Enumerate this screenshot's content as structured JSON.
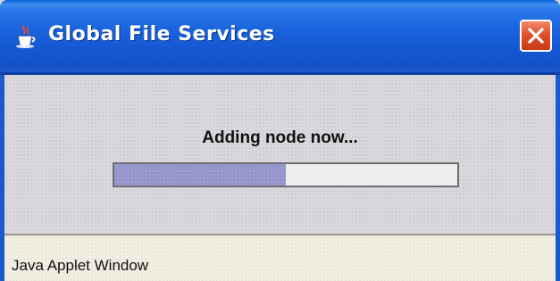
{
  "window": {
    "title": "Global File Services",
    "title_icon": "java-cup-icon",
    "close_icon": "close-icon",
    "titlebar_color": "#1a5ad0",
    "close_color": "#d9481f"
  },
  "content": {
    "status_message": "Adding node now...",
    "progress": {
      "value_percent": 50,
      "fill_color": "#9a9ad0"
    }
  },
  "footer": {
    "applet_banner": "Java Applet Window"
  }
}
